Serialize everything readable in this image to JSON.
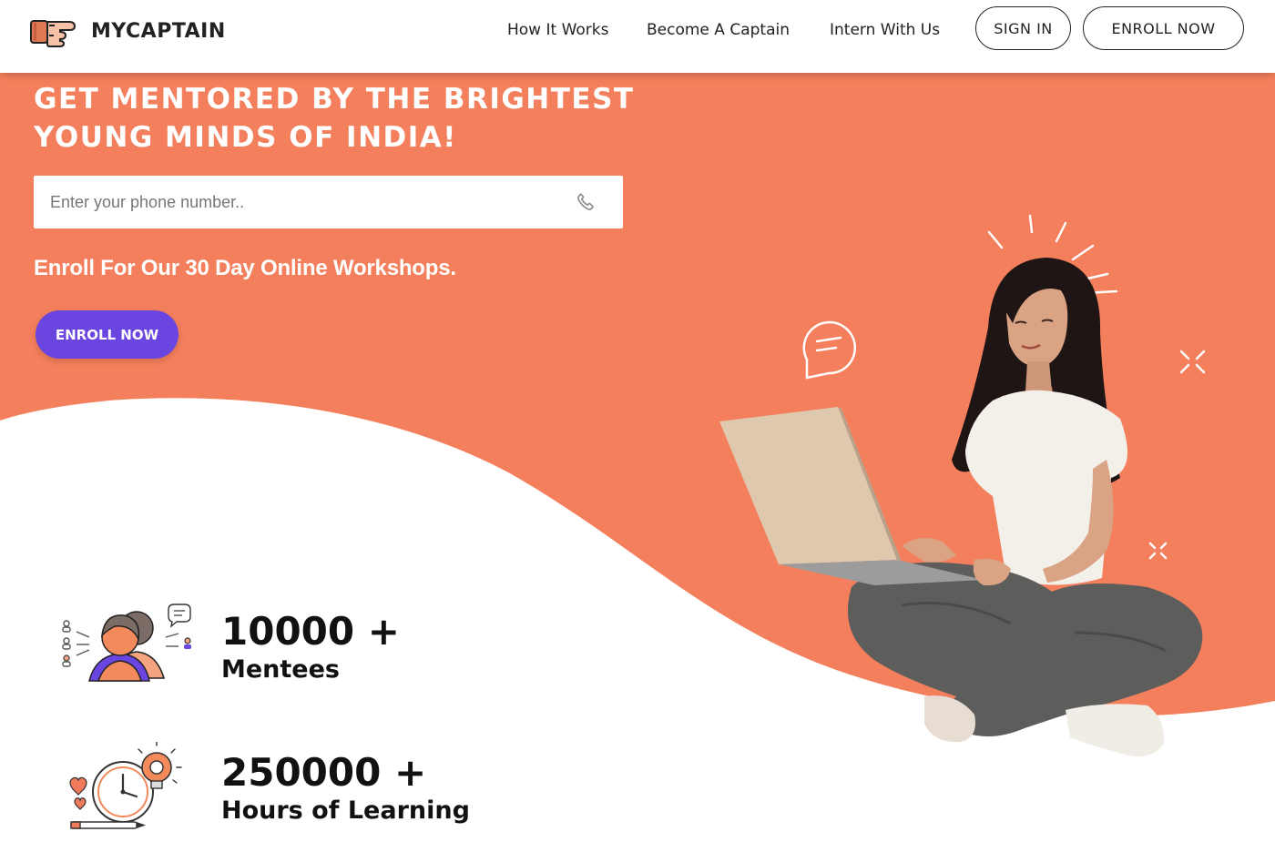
{
  "brand": {
    "name": "MYCAPTAIN",
    "accent_color": "#f47f5c",
    "button_purple": "#6a45e0"
  },
  "nav": {
    "links": [
      "How It Works",
      "Become A Captain",
      "Intern With Us"
    ],
    "signin_label": "SIGN IN",
    "enroll_label": "ENROLL NOW"
  },
  "hero": {
    "headline_line1": "GET MENTORED BY THE BRIGHTEST",
    "headline_line2": "YOUNG MINDS OF INDIA!",
    "phone_placeholder": "Enter your phone number..",
    "phone_icon": "phone-icon",
    "subline": "Enroll For Our 30 Day Online Workshops.",
    "cta_label": "ENROLL NOW"
  },
  "stats": [
    {
      "number": "10000 +",
      "label": "Mentees",
      "icon": "mentees-icon"
    },
    {
      "number": "250000 +",
      "label": "Hours of Learning",
      "icon": "learning-hours-icon"
    }
  ]
}
